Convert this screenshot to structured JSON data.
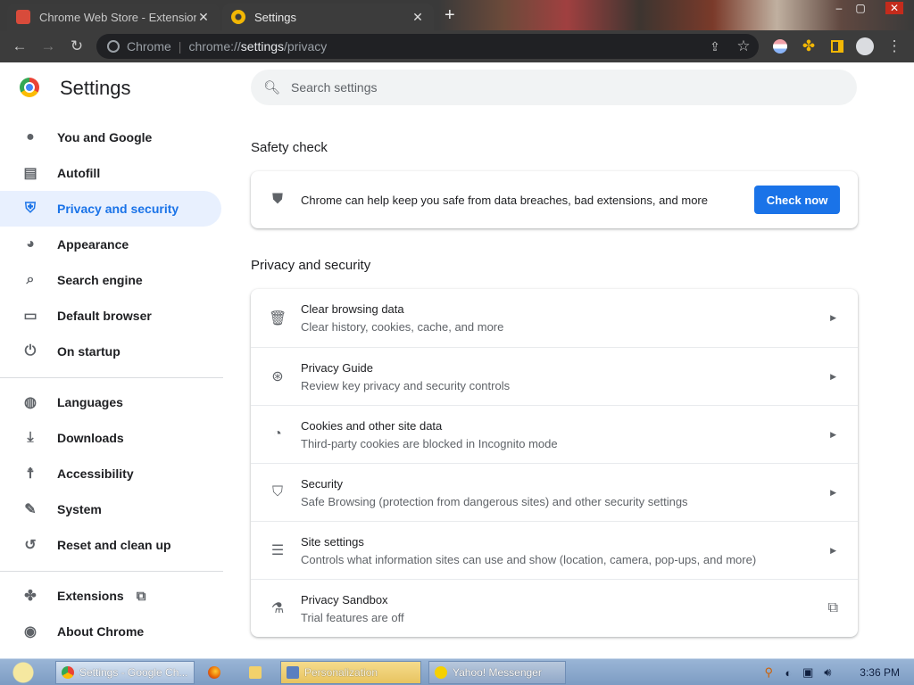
{
  "tabs": [
    {
      "title": "Chrome Web Store - Extensions",
      "close": "✕"
    },
    {
      "title": "Settings",
      "close": "✕"
    }
  ],
  "new_tab": "+",
  "window_controls": {
    "minimize": "–",
    "maximize": "▢",
    "close": "✕"
  },
  "omnibox": {
    "site": "Chrome",
    "url_scheme": "chrome://",
    "url_host": "settings",
    "url_path": "/privacy"
  },
  "settings": {
    "title": "Settings",
    "search_placeholder": "Search settings"
  },
  "sidebar": {
    "items": [
      {
        "label": "You and Google",
        "icon": "person-icon"
      },
      {
        "label": "Autofill",
        "icon": "clipboard-icon"
      },
      {
        "label": "Privacy and security",
        "icon": "shield-icon"
      },
      {
        "label": "Appearance",
        "icon": "palette-icon"
      },
      {
        "label": "Search engine",
        "icon": "search-icon"
      },
      {
        "label": "Default browser",
        "icon": "browser-icon"
      },
      {
        "label": "On startup",
        "icon": "power-icon"
      },
      {
        "label": "Languages",
        "icon": "globe-icon"
      },
      {
        "label": "Downloads",
        "icon": "download-icon"
      },
      {
        "label": "Accessibility",
        "icon": "accessibility-icon"
      },
      {
        "label": "System",
        "icon": "wrench-icon"
      },
      {
        "label": "Reset and clean up",
        "icon": "history-icon"
      },
      {
        "label": "Extensions",
        "icon": "puzzle-icon"
      },
      {
        "label": "About Chrome",
        "icon": "chrome-icon"
      }
    ]
  },
  "safety_check": {
    "title": "Safety check",
    "text": "Chrome can help keep you safe from data breaches, bad extensions, and more",
    "button": "Check now"
  },
  "privacy": {
    "title": "Privacy and security",
    "rows": [
      {
        "title": "Clear browsing data",
        "subtitle": "Clear history, cookies, cache, and more",
        "icon": "trash-icon"
      },
      {
        "title": "Privacy Guide",
        "subtitle": "Review key privacy and security controls",
        "icon": "compass-icon"
      },
      {
        "title": "Cookies and other site data",
        "subtitle": "Third-party cookies are blocked in Incognito mode",
        "icon": "cookie-icon"
      },
      {
        "title": "Security",
        "subtitle": "Safe Browsing (protection from dangerous sites) and other security settings",
        "icon": "shield-half-icon"
      },
      {
        "title": "Site settings",
        "subtitle": "Controls what information sites can use and show (location, camera, pop-ups, and more)",
        "icon": "sliders-icon"
      },
      {
        "title": "Privacy Sandbox",
        "subtitle": "Trial features are off",
        "icon": "flask-icon"
      }
    ]
  },
  "taskbar": {
    "items": [
      "Settings - Google Ch...",
      "Personalization",
      "Yahoo! Messenger"
    ],
    "clock": "3:36 PM"
  },
  "colors": {
    "accent": "#1a73e8",
    "active_nav_bg": "#e8f0fe",
    "toolbar": "#3c3c3c"
  }
}
